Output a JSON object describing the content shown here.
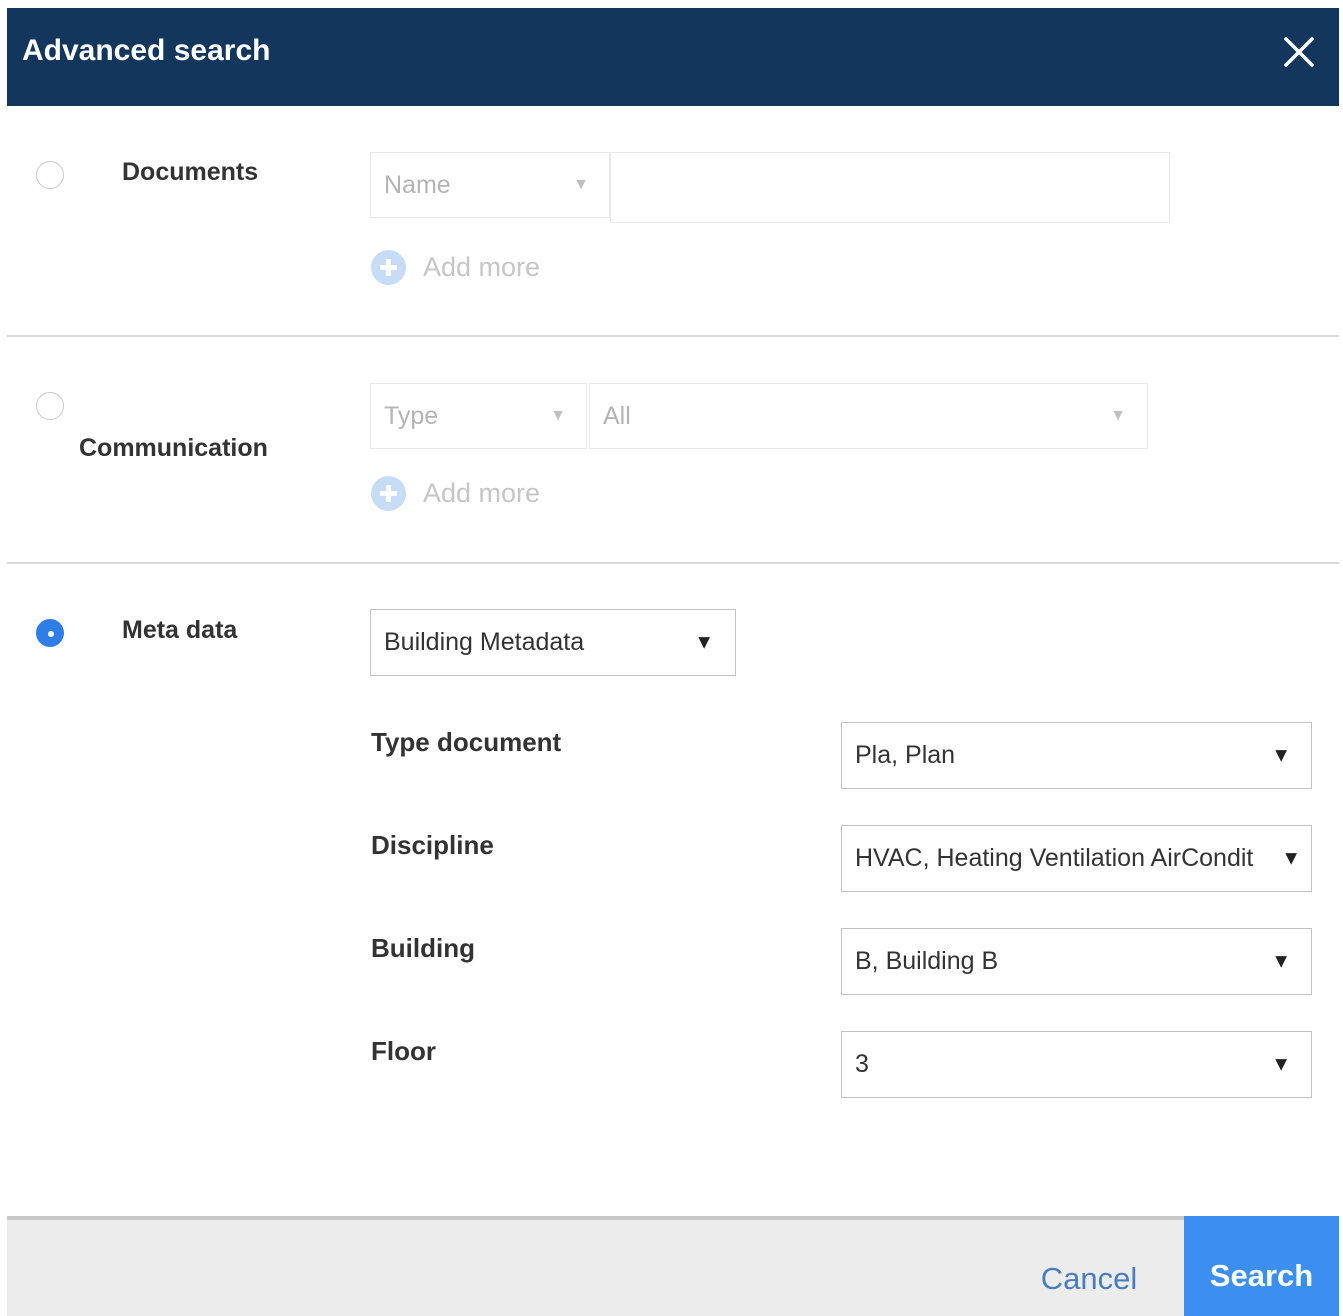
{
  "dialog": {
    "title": "Advanced search",
    "close_icon": "close-icon"
  },
  "documents": {
    "label": "Documents",
    "selected": false,
    "field_select": "Name",
    "text_value": "",
    "add_more": "Add more"
  },
  "communication": {
    "label": "Communication",
    "selected": false,
    "type_select": "Type",
    "value_select": "All",
    "add_more": "Add more"
  },
  "metadata": {
    "label": "Meta data",
    "selected": true,
    "scheme_select": "Building Metadata",
    "fields": [
      {
        "label": "Type document",
        "value": "Pla, Plan"
      },
      {
        "label": "Discipline",
        "value": "HVAC, Heating Ventilation AirCondit"
      },
      {
        "label": "Building",
        "value": "B, Building B"
      },
      {
        "label": "Floor",
        "value": "3"
      }
    ]
  },
  "footer": {
    "cancel_label": "Cancel",
    "search_label": "Search"
  },
  "colors": {
    "header_bg": "#13365c",
    "accent": "#3a8ff0",
    "radio_checked": "#2f7ee8",
    "cancel_text": "#4a7dbf"
  }
}
